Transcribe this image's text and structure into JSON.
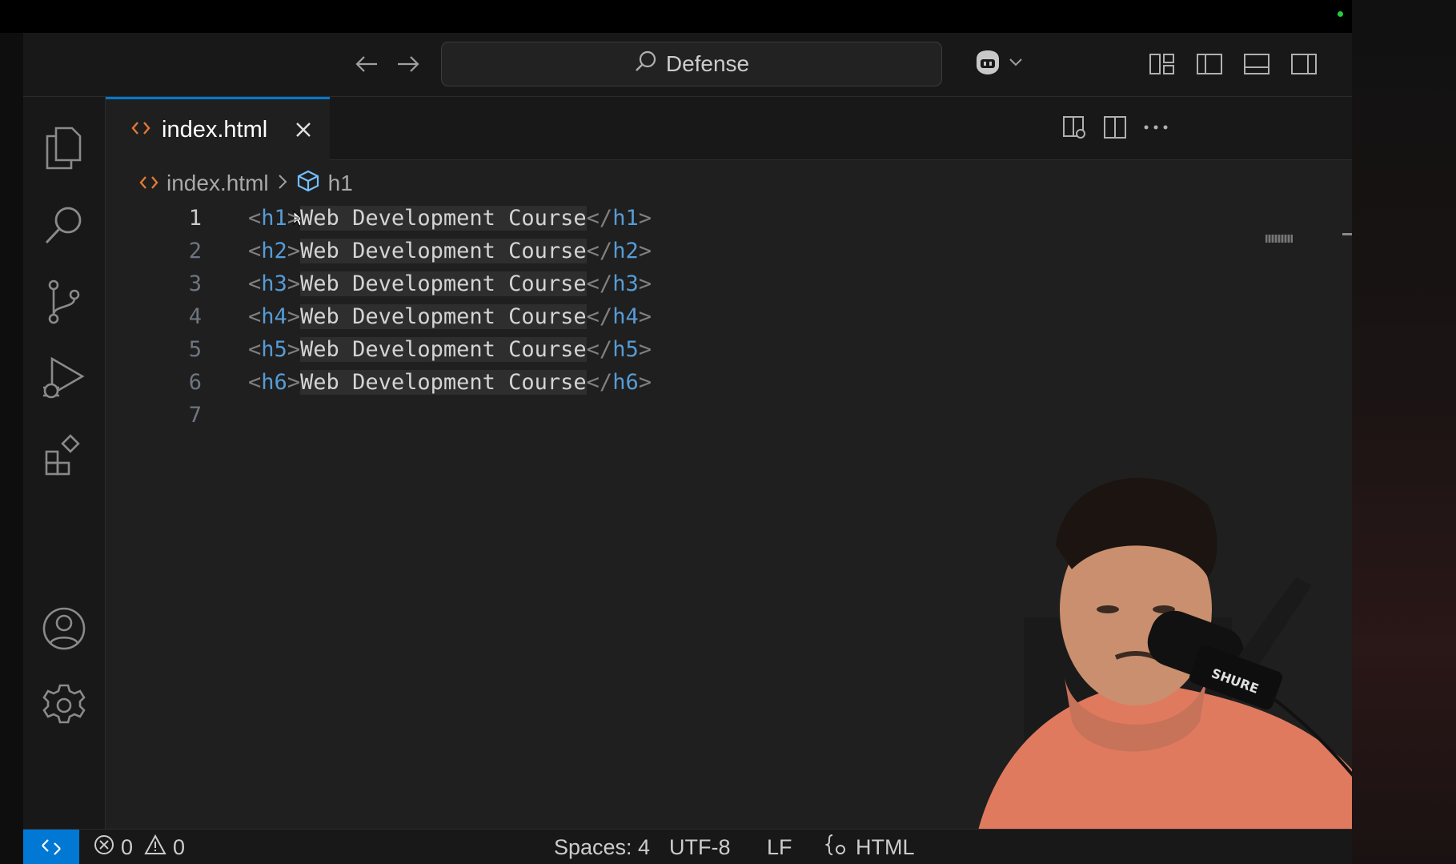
{
  "titlebar": {
    "search_text": "Defense"
  },
  "tab": {
    "label": "index.html"
  },
  "breadcrumb": {
    "file": "index.html",
    "symbol": "h1"
  },
  "editor": {
    "lines": [
      {
        "num": "1",
        "open": "h1",
        "text": "Web Development Course",
        "close": "h1"
      },
      {
        "num": "2",
        "open": "h2",
        "text": "Web Development Course",
        "close": "h2"
      },
      {
        "num": "3",
        "open": "h3",
        "text": "Web Development Course",
        "close": "h3"
      },
      {
        "num": "4",
        "open": "h4",
        "text": "Web Development Course",
        "close": "h4"
      },
      {
        "num": "5",
        "open": "h5",
        "text": "Web Development Course",
        "close": "h5"
      },
      {
        "num": "6",
        "open": "h6",
        "text": "Web Development Course",
        "close": "h6"
      },
      {
        "num": "7",
        "open": "",
        "text": "",
        "close": ""
      }
    ]
  },
  "statusbar": {
    "errors": "0",
    "warnings": "0",
    "spaces": "Spaces: 4",
    "encoding": "UTF-8",
    "eol": "LF",
    "language": "HTML"
  },
  "colors": {
    "accent": "#0078d4",
    "tag": "#569cd6",
    "file_icon": "#e37933"
  },
  "icons": [
    "back-arrow-icon",
    "forward-arrow-icon",
    "search-icon",
    "copilot-icon",
    "explorer-icon",
    "source-control-icon",
    "run-debug-icon",
    "extensions-icon",
    "account-icon",
    "settings-gear-icon",
    "remote-icon"
  ]
}
